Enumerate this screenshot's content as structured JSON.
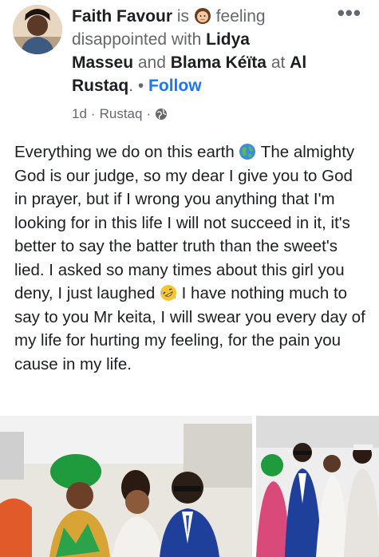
{
  "post": {
    "author": "Faith Favour",
    "is_text": " is ",
    "feeling_text": " feeling disappointed with ",
    "tag1": "Lidya Masseu",
    "and_text": " and ",
    "tag2": "Blama Kéïta",
    "at_text": " at ",
    "location": "Al Rustaq",
    "dot": ". • ",
    "follow_label": "Follow",
    "time": "1d",
    "meta_sep": "·",
    "meta_place": "Rustaq",
    "menu": "•••",
    "body_part1": "Everything we do on this earth ",
    "body_part2": " The almighty God is our judge, so  my dear I give you to God in prayer, but if I wrong you anything that I'm looking for in this life I will not succeed in it,  it's better to say the batter truth than the sweet's lied. I asked so many times about this girl you deny, I just laughed ",
    "body_part3": " I have nothing much to say to you Mr keita, I will swear you every day of my life for hurting my feeling, for the pain you cause in my life."
  },
  "icons": {
    "feeling": "woman-face-icon",
    "earth": "globe-earth-icon",
    "laugh": "rolling-laughing-icon",
    "privacy": "public-globe-icon"
  },
  "colors": {
    "link_blue": "#1877f2",
    "secondary_text": "#65676b",
    "primary_text": "#1c1e21"
  }
}
